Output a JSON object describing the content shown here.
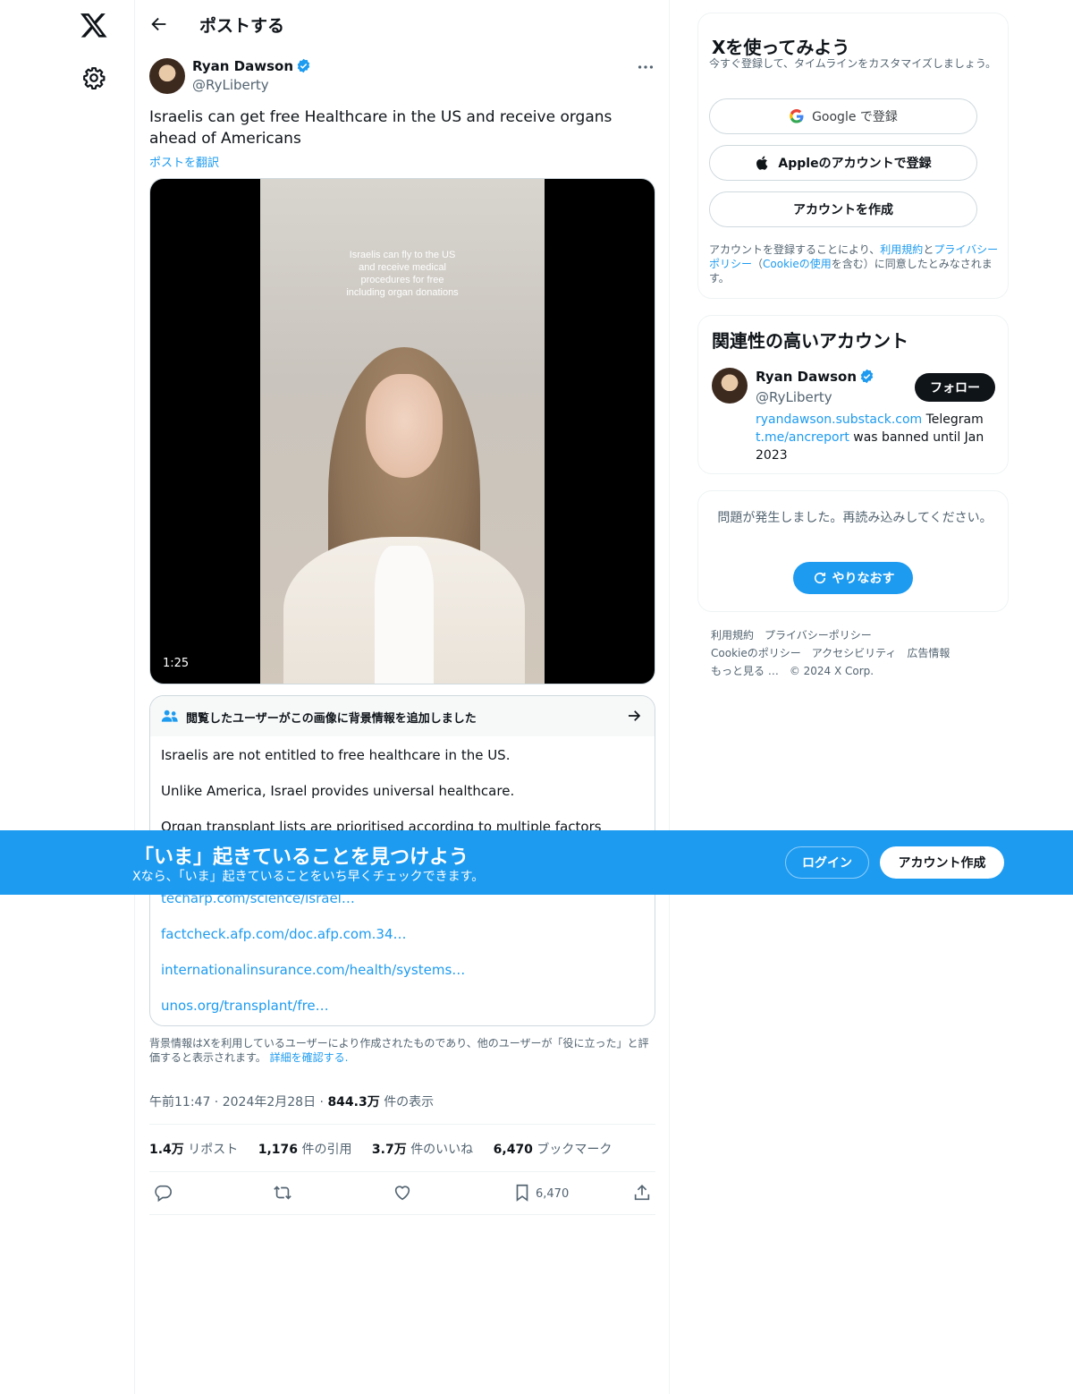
{
  "header": {
    "title": "ポストする"
  },
  "post": {
    "author_name": "Ryan Dawson",
    "author_handle": "@RyLiberty",
    "text": "Israelis can get free Healthcare in the US and receive organs ahead of Americans",
    "translate_label": "ポストを翻訳",
    "video": {
      "caption_lines": [
        "Israelis can fly to the US",
        "and receive medical",
        "procedures for free",
        "including organ donations"
      ],
      "duration": "1:25"
    },
    "community_note": {
      "title": "閲覧したユーザーがこの画像に背景情報を追加しました",
      "paragraphs": [
        "Israelis are not entitled to free healthcare in the US.",
        "Unlike America, Israel provides universal healthcare.",
        "Organ transplant lists are prioritised according to multiple factors"
      ],
      "links": [
        "techarp.com/science/israel…",
        "factcheck.afp.com/doc.afp.com.34…",
        "internationalinsurance.com/health/systems…",
        "unos.org/transplant/fre…"
      ]
    },
    "note_footer_text": "背景情報はXを利用しているユーザーにより作成されたものであり、他のユーザーが「役に立った」と評価すると表示されます。",
    "note_footer_link": "詳細を確認する.",
    "time": "午前11:47",
    "date": "2024年2月28日",
    "views_count": "844.3万",
    "views_label": "件の表示",
    "stats": {
      "reposts_count": "1.4万",
      "reposts_label": "リポスト",
      "quotes_count": "1,176",
      "quotes_label": "件の引用",
      "likes_count": "3.7万",
      "likes_label": "件のいいね",
      "bookmarks_count": "6,470",
      "bookmarks_label": "ブックマーク"
    },
    "bookmark_action_count": "6,470"
  },
  "sidebar": {
    "signup": {
      "title": "Xを使ってみよう",
      "subtitle": "今すぐ登録して、タイムラインをカスタマイズしましょう。",
      "google_label": "Google で登録",
      "apple_label": "Appleのアカウントで登録",
      "create_label": "アカウントを作成",
      "legal_prefix": "アカウントを登録することにより、",
      "legal_terms": "利用規約",
      "legal_and": "と",
      "legal_privacy": "プライバシーポリシー",
      "legal_open": "（",
      "legal_cookie": "Cookieの使用",
      "legal_suffix": "を含む）に同意したとみなされます。"
    },
    "relevant": {
      "title": "関連性の高いアカウント",
      "name": "Ryan Dawson",
      "handle": "@RyLiberty",
      "follow_label": "フォロー",
      "bio_link1": "ryandawson.substack.com",
      "bio_text1": " Telegram ",
      "bio_link2": "t.me/ancreport",
      "bio_text2": " was banned until Jan 2023"
    },
    "error": {
      "message": "問題が発生しました。再読み込みしてください。",
      "retry_label": "やりなおす"
    },
    "footer": {
      "links": [
        "利用規約",
        "プライバシーポリシー",
        "Cookieのポリシー",
        "アクセシビリティ",
        "広告情報",
        "もっと見る …"
      ],
      "copyright": "© 2024 X Corp."
    }
  },
  "banner": {
    "title": "「いま」起きていることを見つけよう",
    "subtitle": "Xなら、「いま」起きていることをいち早くチェックできます。",
    "login_label": "ログイン",
    "signup_label": "アカウント作成"
  },
  "colors": {
    "accent": "#1d9bf0",
    "text": "#0f1419",
    "muted": "#536471"
  }
}
